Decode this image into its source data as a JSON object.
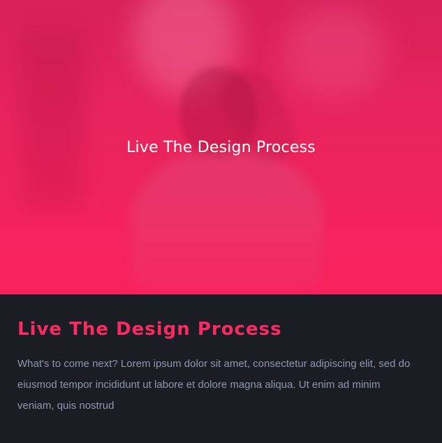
{
  "hero": {
    "title": "Live The Design Process"
  },
  "content": {
    "title": "Live The Design Process",
    "body": "What's to come next? Lorem ipsum dolor sit amet, consectetur adipiscing elit, sed do eiusmod tempor incididunt ut labore et dolore magna aliqua. Ut enim ad minim veniam, quis nostrud"
  },
  "colors": {
    "accent": "#fb2a63",
    "hero_overlay": "#f7225d",
    "background": "#1b1d24",
    "body_text": "#8f97ab"
  }
}
